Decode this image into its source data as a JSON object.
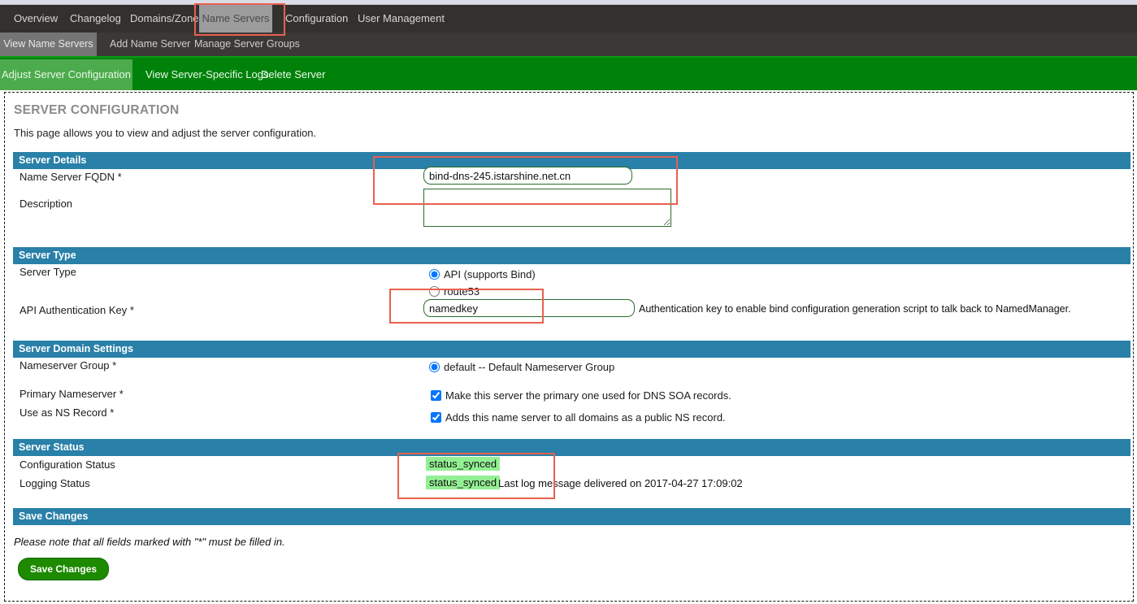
{
  "nav": {
    "primary": [
      {
        "label": "Overview",
        "active": false
      },
      {
        "label": "Changelog",
        "active": false
      },
      {
        "label": "Domains/Zones",
        "active": false
      },
      {
        "label": "Name Servers",
        "active": true
      },
      {
        "label": "Configuration",
        "active": false
      },
      {
        "label": "User Management",
        "active": false
      }
    ],
    "secondary": [
      {
        "label": "View Name Servers",
        "active": true
      },
      {
        "label": "Add Name Server",
        "active": false
      },
      {
        "label": "Manage Server Groups",
        "active": false
      }
    ],
    "actions": [
      {
        "label": "Adjust Server Configuration",
        "active": true
      },
      {
        "label": "View Server-Specific Logs",
        "active": false
      },
      {
        "label": "Delete Server",
        "active": false
      }
    ]
  },
  "page": {
    "title": "SERVER CONFIGURATION",
    "intro": "This page allows you to view and adjust the server configuration."
  },
  "sections": {
    "server_details": {
      "header": "Server Details",
      "fqdn_label": "Name Server FQDN *",
      "fqdn_value": "bind-dns-245.istarshine.net.cn",
      "description_label": "Description",
      "description_value": ""
    },
    "server_type": {
      "header": "Server Type",
      "type_label": "Server Type",
      "options": [
        {
          "label": "API (supports Bind)",
          "checked": true
        },
        {
          "label": "route53",
          "checked": false
        }
      ],
      "auth_key_label": "API Authentication Key *",
      "auth_key_value": "namedkey",
      "auth_key_hint": "Authentication key to enable bind configuration generation script to talk back to NamedManager."
    },
    "domain_settings": {
      "header": "Server Domain Settings",
      "nameserver_group_label": "Nameserver Group *",
      "nameserver_group_option": "default -- Default Nameserver Group",
      "primary_nameserver_label": "Primary Nameserver *",
      "primary_nameserver_option": "Make this server the primary one used for DNS SOA records.",
      "ns_record_label": "Use as NS Record *",
      "ns_record_option": "Adds this name server to all domains as a public NS record."
    },
    "server_status": {
      "header": "Server Status",
      "config_status_label": "Configuration Status",
      "config_status_value": "status_synced",
      "logging_status_label": "Logging Status",
      "logging_status_value": "status_synced",
      "logging_status_note": "Last log message delivered on 2017-04-27 17:09:02"
    },
    "save_changes": {
      "header": "Save Changes",
      "note": "Please note that all fields marked with \"*\" must be filled in.",
      "button_label": "Save Changes"
    }
  },
  "colors": {
    "section_header": "#2980a8",
    "action_bar": "#00820a",
    "nav_bar": "#33312f",
    "status_badge": "#93ef93",
    "annotation": "#e8604e",
    "save_button": "#1d8a00"
  }
}
